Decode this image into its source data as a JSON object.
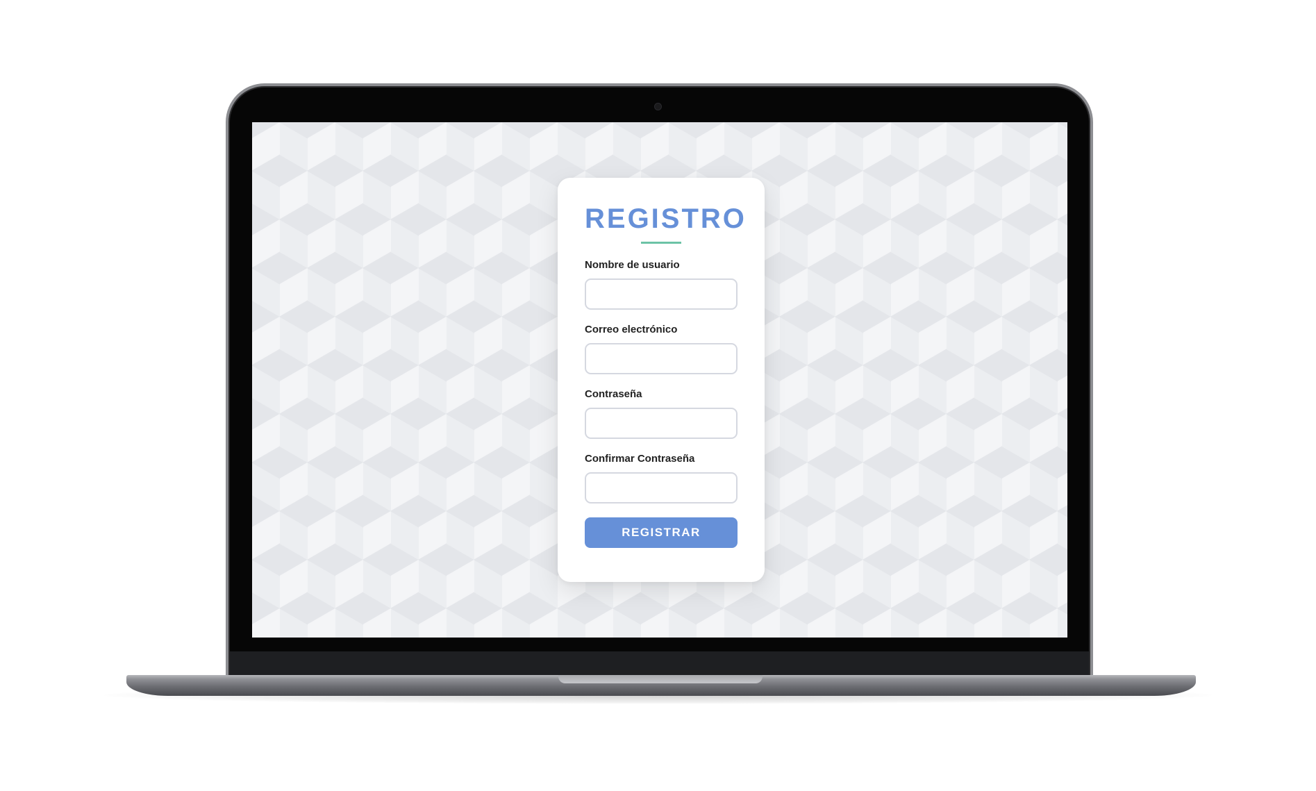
{
  "form": {
    "title": "REGISTRO",
    "fields": [
      {
        "label": "Nombre de usuario",
        "value": "",
        "type": "text"
      },
      {
        "label": "Correo electrónico",
        "value": "",
        "type": "email"
      },
      {
        "label": "Contraseña",
        "value": "",
        "type": "password"
      },
      {
        "label": "Confirmar Contraseña",
        "value": "",
        "type": "password"
      }
    ],
    "submit_label": "REGISTRAR"
  },
  "colors": {
    "accent": "#6690d8",
    "title_underline": "#6cc3a6",
    "label_text": "#222222",
    "input_border": "#d5d8e0"
  },
  "icons": {
    "camera": "webcam-dot"
  }
}
